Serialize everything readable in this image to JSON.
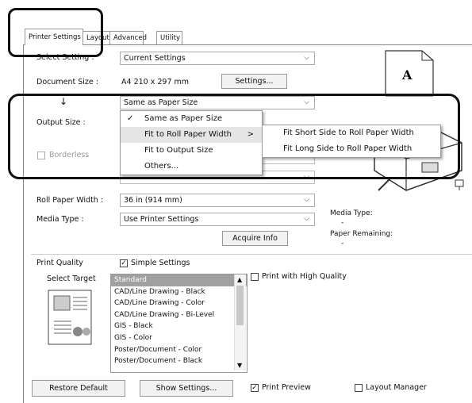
{
  "tabs": [
    "Printer Settings",
    "Layout",
    "Advanced",
    "Utility"
  ],
  "select_setting": {
    "label": "Select Setting :",
    "value": "Current Settings"
  },
  "document_size": {
    "label": "Document Size :",
    "value": "A4 210 x 297 mm",
    "button": "Settings..."
  },
  "arrow_glyph": "↓",
  "output_size": {
    "label": "Output Size :",
    "value": "Same as Paper Size"
  },
  "borderless": {
    "label": "Borderless"
  },
  "roll_paper_width": {
    "label": "Roll Paper Width :",
    "value": "36 in (914 mm)"
  },
  "media_type": {
    "label": "Media Type :",
    "value": "Use Printer Settings"
  },
  "acquire_info": "Acquire Info",
  "preview_letter": "A",
  "info": {
    "media_type_label": "Media Type:",
    "media_type_value": "-",
    "paper_remaining_label": "Paper Remaining:",
    "paper_remaining_value": "-"
  },
  "dropdown": {
    "items": [
      "Same as Paper Size",
      "Fit to Roll Paper Width",
      "Fit to Output Size",
      "Others..."
    ],
    "check_mark": "✓",
    "submenu_arrow": ">",
    "submenu": [
      "Fit Short Side to Roll Paper Width",
      "Fit Long Side to Roll Paper Width"
    ]
  },
  "print_quality": {
    "label": "Print Quality",
    "simple_settings": "Simple Settings",
    "select_target": "Select Target",
    "high_quality": "Print with High Quality"
  },
  "targets": [
    "Standard",
    "CAD/Line Drawing - Black",
    "CAD/Line Drawing - Color",
    "CAD/Line Drawing - Bi-Level",
    "GIS - Black",
    "GIS - Color",
    "Poster/Document - Color",
    "Poster/Document - Black"
  ],
  "bottom": {
    "restore_default": "Restore Default",
    "show_settings": "Show Settings...",
    "print_preview": "Print Preview",
    "layout_manager": "Layout Manager"
  },
  "colors": {
    "callout": "#111111",
    "selection": "#a0a0a0",
    "menu_highlight": "#e5e5e5"
  }
}
